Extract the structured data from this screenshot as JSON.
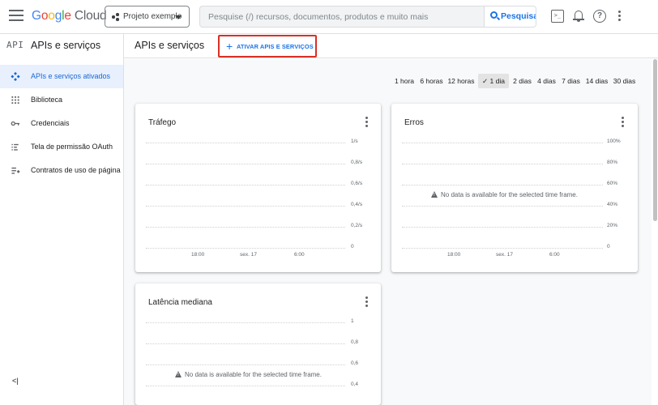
{
  "topbar": {
    "logo_parts": [
      "G",
      "o",
      "o",
      "g",
      "l",
      "e"
    ],
    "logo_cloud": "Cloud",
    "project_name": "Projeto exemplo",
    "search_placeholder": "Pesquise (/) recursos, documentos, produtos e muito mais",
    "search_button": "Pesquisa",
    "terminal_glyph": ">_",
    "help_glyph": "?"
  },
  "sidebar": {
    "badge": "API",
    "title": "APIs e serviços",
    "items": [
      {
        "label": "APIs e serviços ativados",
        "icon": "api-diamond-icon",
        "active": true
      },
      {
        "label": "Biblioteca",
        "icon": "library-icon",
        "active": false
      },
      {
        "label": "Credenciais",
        "icon": "key-icon",
        "active": false
      },
      {
        "label": "Tela de permissão OAuth",
        "icon": "oauth-consent-icon",
        "active": false
      },
      {
        "label": "Contratos de uso de página",
        "icon": "page-usage-icon",
        "active": false
      }
    ],
    "collapse_glyph": "<|"
  },
  "main": {
    "title": "APIs e serviços",
    "enable_button": "ATIVAR APIS E SERVIÇOS",
    "enable_icon": "+"
  },
  "time_range": {
    "options": [
      "1 hora",
      "6 horas",
      "12 horas",
      "1 dia",
      "2 dias",
      "4 dias",
      "7 dias",
      "14 dias",
      "30 dias"
    ],
    "selected": "1 dia",
    "check_glyph": "✓"
  },
  "cards": {
    "traffic": {
      "title": "Tráfego",
      "y_labels": [
        "1/s",
        "0,8/s",
        "0,6/s",
        "0,4/s",
        "0,2/s",
        "0"
      ],
      "x_labels": [
        "18:00",
        "sex. 17",
        "6:00"
      ]
    },
    "errors": {
      "title": "Erros",
      "y_labels": [
        "100%",
        "80%",
        "60%",
        "40%",
        "20%",
        "0"
      ],
      "x_labels": [
        "18:00",
        "sex. 17",
        "6:00"
      ],
      "no_data": "No data is available for the selected time frame."
    },
    "latency": {
      "title": "Latência mediana",
      "y_labels": [
        "1",
        "0,8",
        "0,6",
        "0,4"
      ],
      "no_data": "No data is available for the selected time frame."
    }
  },
  "colors": {
    "accent": "#1a73e8",
    "highlight_border": "#d93025",
    "active_nav_bg": "#e8f0fe"
  }
}
